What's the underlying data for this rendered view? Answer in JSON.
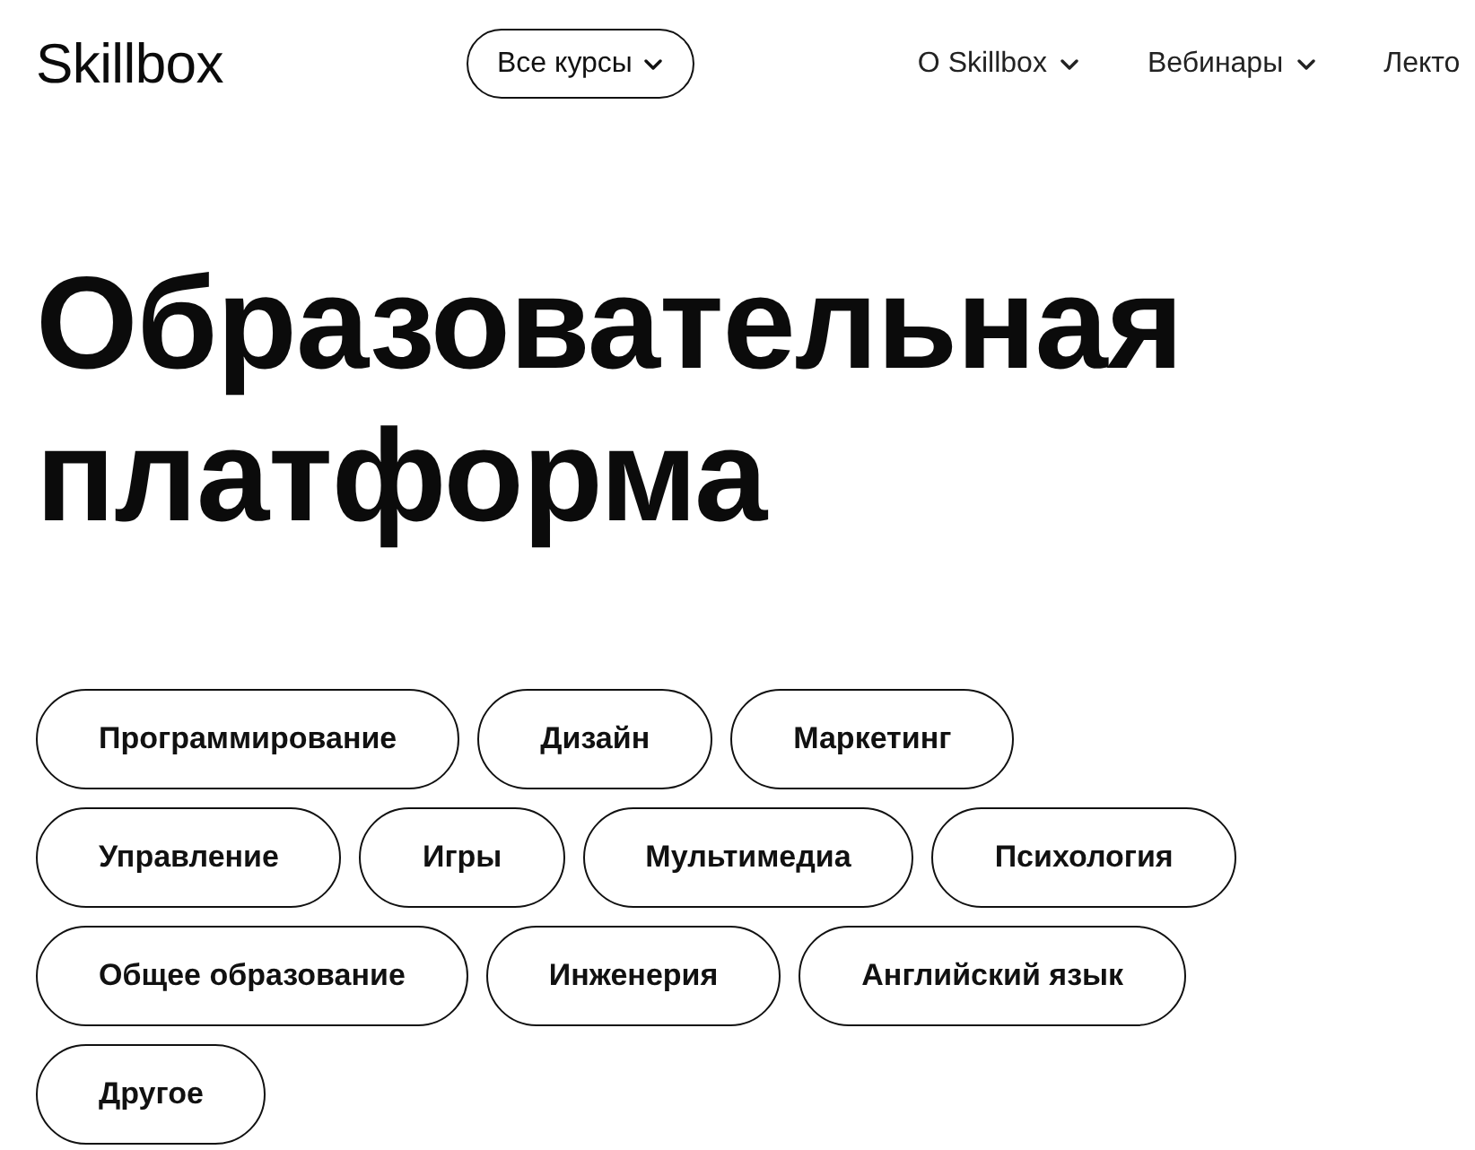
{
  "header": {
    "logo": "Skillbox",
    "courses_button": {
      "label": "Все курсы",
      "dropdown": true
    },
    "nav": [
      {
        "label": "О Skillbox",
        "dropdown": true
      },
      {
        "label": "Вебинары",
        "dropdown": true
      },
      {
        "label": "Лекто",
        "dropdown": false
      }
    ]
  },
  "hero": {
    "title": "Образовательная платформа"
  },
  "categories": [
    "Программирование",
    "Дизайн",
    "Маркетинг",
    "Управление",
    "Игры",
    "Мультимедиа",
    "Психология",
    "Общее образование",
    "Инженерия",
    "Английский язык",
    "Другое"
  ]
}
